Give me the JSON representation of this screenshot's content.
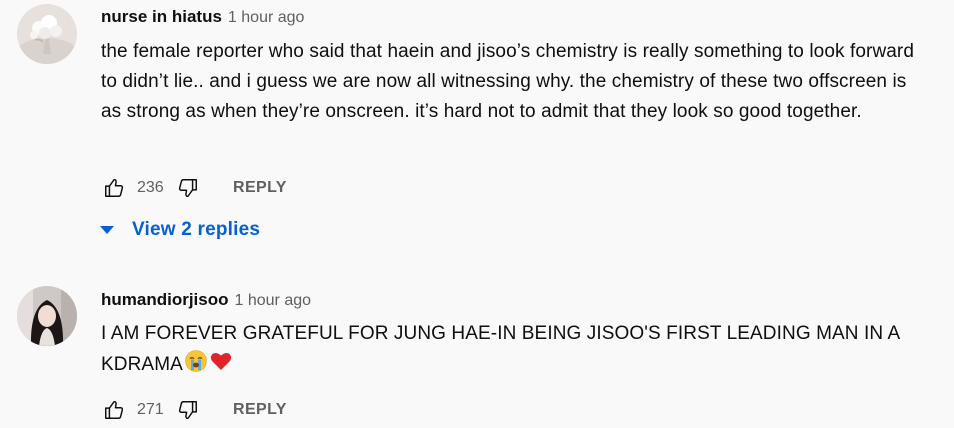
{
  "comments": [
    {
      "author": "nurse in hiatus",
      "time": "1 hour ago",
      "text": "the female reporter who said that haein and jisoo’s chemistry is really something to look forward to didn’t lie.. and i guess we are now all witnessing why. the chemistry of these two offscreen is as strong as when they’re onscreen. it’s hard not to admit that they look so good together.",
      "likes": "236",
      "reply_label": "REPLY",
      "view_replies_label": "View 2 replies"
    },
    {
      "author": "humandiorjisoo",
      "time": "1 hour ago",
      "text": "I AM FOREVER GRATEFUL FOR JUNG HAE-IN BEING JISOO'S FIRST LEADING MAN IN A KDRAMA",
      "emojis": [
        "loudly-crying-face-icon",
        "red-heart-icon"
      ],
      "likes": "271",
      "reply_label": "REPLY"
    }
  ],
  "colors": {
    "background": "#f9f9f9",
    "link_blue": "#065fd4",
    "secondary_text": "#606060",
    "heart_red": "#e0242b"
  }
}
